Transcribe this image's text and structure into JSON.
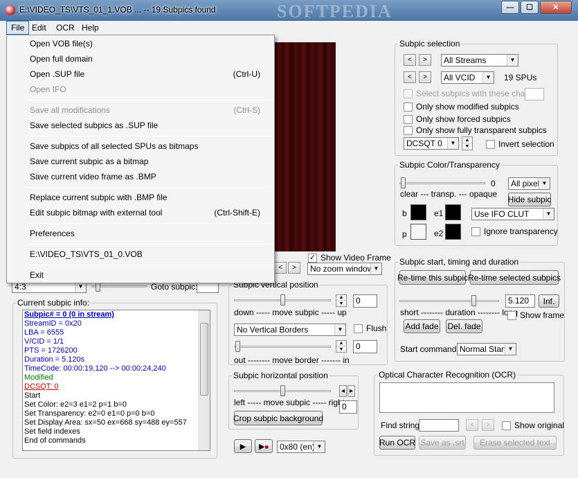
{
  "window": {
    "title": "E:\\VIDEO_TS\\VTS_01_1.VOB ... -- 19 Subpics found",
    "watermark": "SOFTPEDIA",
    "minimize": "—",
    "maximize": "☐",
    "close": "✕"
  },
  "menu": {
    "items": [
      "File",
      "Edit",
      "OCR",
      "Help"
    ]
  },
  "file_menu": {
    "open_vob": "Open VOB file(s)",
    "open_full_domain": "Open full domain",
    "open_sup": "Open .SUP file",
    "open_sup_shortcut": "(Ctrl-U)",
    "open_ifo": "Open IFO",
    "save_all": "Save all modifications",
    "save_all_shortcut": "(Ctrl-S)",
    "save_selected_sup": "Save selected subpics as .SUP file",
    "save_spus_bitmaps": "Save subpics of all selected SPUs as bitmaps",
    "save_current_bitmap": "Save current subpic as a bitmap",
    "save_video_frame": "Save current video frame as .BMP",
    "replace_subpic": "Replace current subpic with .BMP file",
    "edit_external": "Edit subpic bitmap with external tool",
    "edit_external_shortcut": "(Ctrl-Shift-E)",
    "preferences": "Preferences",
    "recent_file": "E:\\VIDEO_TS\\VTS_01_0.VOB",
    "exit": "Exit"
  },
  "left": {
    "aspect_value": "4:3",
    "goto_label": "Goto subpic:",
    "current_info_legend": "Current subpic info:",
    "info_lines": [
      {
        "text": "Subpic# = 0 (0 in stream)",
        "color": "#0000cc"
      },
      {
        "text": "StreamID = 0x20",
        "color": "#0000cc"
      },
      {
        "text": "LBA = 6555",
        "color": "#0000cc"
      },
      {
        "text": "V/CID = 1/1",
        "color": "#0000cc"
      },
      {
        "text": "PTS = 1726200",
        "color": "#0000cc"
      },
      {
        "text": "Duration = 5.120s",
        "color": "#0000cc"
      },
      {
        "text": "TimeCode: 00:00:19,120 --> 00:00:24,240",
        "color": "#0000cc"
      },
      {
        "text": "Modified",
        "color": "#008000"
      },
      {
        "text": "DCSQT: 0",
        "color": "#cc0000"
      },
      {
        "text": "  Start",
        "color": "#000000"
      },
      {
        "text": "  Set Color: e2=3 e1=2 p=1 b=0",
        "color": "#000000"
      },
      {
        "text": "  Set Transparency: e2=0 e1=0 p=0 b=0",
        "color": "#000000"
      },
      {
        "text": "  Set Display Area: sx=50 ex=668 sy=488 ey=557",
        "color": "#000000"
      },
      {
        "text": "  Set field indexes",
        "color": "#000000"
      },
      {
        "text": "  End of commands",
        "color": "#000000"
      }
    ]
  },
  "video": {
    "show_video_frame": "Show Video Frame",
    "zoom": "No zoom window"
  },
  "vertical": {
    "legend": "Subpic vertical position",
    "move_caption": "down ----- move subpic ----- up",
    "move_value": "0",
    "borders": "No Vertical Borders",
    "flush": "Flush",
    "border_caption": "out -------- move border ------- in",
    "border_value": "0"
  },
  "horizontal": {
    "legend": "Subpic horizontal position",
    "caption": "left ----- move subpic ----- right",
    "value": "0",
    "crop_button": "Crop subpic background"
  },
  "playback": {
    "stream": "0x80 (en)"
  },
  "selection": {
    "legend": "Subpic selection",
    "streams": "All Streams",
    "vcid": "All VCID",
    "spus": "19 SPUs",
    "select_chars": "Select subpics with these chars",
    "only_modified": "Only show modified subpics",
    "only_forced": "Only show forced subpics",
    "only_transparent": "Only show fully transparent subpics",
    "dcsqt": "DCSQT 0",
    "invert": "Invert selection"
  },
  "color": {
    "legend": "Subpic Color/Transparency",
    "slider_value": "0",
    "caption": "clear --- transp. --- opaque",
    "pixels": "All pixels",
    "hide_button": "Hide subpic",
    "b_label": "b",
    "e1_label": "e1",
    "p_label": "p",
    "e2_label": "e2",
    "b_color": "#000000",
    "e1_color": "#000000",
    "p_color": "#f5f5f5",
    "e2_color": "#000000",
    "clut": "Use IFO CLUT",
    "ignore_transparency": "Ignore transparency"
  },
  "timing": {
    "legend": "Subpic start, timing and duration",
    "retime_button": "Re-time this subpic",
    "retime_selected_button": "Re-time selected subpics",
    "duration_caption": "short -------- duration -------- long",
    "duration_value": "5.120",
    "inf_button": "Inf.",
    "show_frame": "Show frame",
    "add_fade": "Add fade",
    "del_fade": "Del. fade",
    "start_command_label": "Start command:",
    "start_command": "Normal Start"
  },
  "ocr": {
    "legend": "Optical Character Recognition (OCR)",
    "find_label": "Find string:",
    "show_original": "Show original",
    "run_button": "Run OCR",
    "save_button": "Save as .srt",
    "erase_button": "Erase selected text"
  }
}
